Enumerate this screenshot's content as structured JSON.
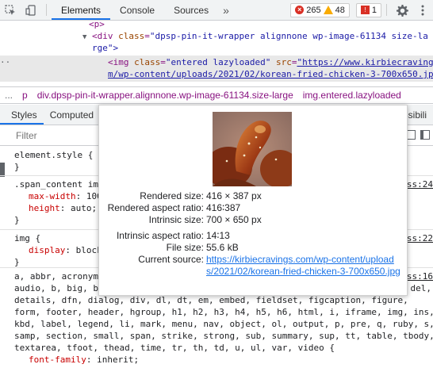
{
  "toolbar": {
    "tabs": [
      "Elements",
      "Console",
      "Sources"
    ],
    "more_label": "»",
    "error_count": "265",
    "warning_count": "48",
    "issues_count": "1"
  },
  "dom": {
    "line1": "<p>",
    "line2_tag_open": "<div",
    "line2_attr": "class",
    "line2_val": "\"dpsp-pin-it-wrapper alignnone wp-image-61134 size-la",
    "line3": "rge\">",
    "line4_tag": "<img",
    "line4_attr1": "class",
    "line4_val1": "\"entered lazyloaded\"",
    "line4_attr2": "src",
    "line4_link": "\"https://www.kirbiecravings.co",
    "line5_link": "m/wp-content/uploads/2021/02/korean-fried-chicken-3-700x650.jp"
  },
  "breadcrumbs": {
    "dots": "...",
    "p": "p",
    "div": "div.dpsp-pin-it-wrapper.alignnone.wp-image-61134.size-large",
    "img": "img.entered.lazyloaded"
  },
  "subtabs": [
    "Styles",
    "Computed",
    "essibili"
  ],
  "filter": {
    "placeholder": "Filter",
    "value": ""
  },
  "styles": {
    "element_style": "element.style {",
    "element_close": "}",
    "rule2_selector": ".span_content img",
    "rule2_src": "css:24",
    "rule2_prop1": "max-width",
    "rule2_val1": "100",
    "rule2_prop2": "height",
    "rule2_val2": "auto;",
    "rule2_close": "}",
    "rule3_selector": "img {",
    "rule3_src": "css:22",
    "rule3_prop": "display",
    "rule3_val": "block",
    "rule3_close": "}",
    "rule4_line1": "a, abbr, acronym",
    "rule4_src": "css:16",
    "rule4_line2": "audio, b, big, bl",
    "rule4_line2_end": "del,",
    "rule4_line3": "details, dfn, dialog, div, dl, dt, em, embed, fieldset, figcaption, figure,",
    "rule4_line4": "form, footer, header, hgroup, h1, h2, h3, h4, h5, h6, html, i, iframe, img, ins,",
    "rule4_line5": "kbd, label, legend, li, mark, menu, nav, object, ol, output, p, pre, q, ruby, s,",
    "rule4_line6": "samp, section, small, span, strike, strong, sub, summary, sup, tt, table, tbody,",
    "rule4_line7": "textarea, tfoot, thead, time, tr, th, td, u, ul, var, video {",
    "rule4_prop": "font-family",
    "rule4_val": "inherit;"
  },
  "tooltip": {
    "rows": [
      {
        "label": "Rendered size:",
        "value": "416 × 387 px"
      },
      {
        "label": "Rendered aspect ratio:",
        "value": "416∶387"
      },
      {
        "label": "Intrinsic size:",
        "value": "700 × 650 px"
      },
      {
        "label": "Intrinsic aspect ratio:",
        "value": "14∶13"
      },
      {
        "label": "File size:",
        "value": "55.6 kB"
      }
    ],
    "source_label": "Current source:",
    "source_url": "https://kirbiecravings.com/wp-content/uploads/2021/02/korean-fried-chicken-3-700x650.jpg"
  }
}
